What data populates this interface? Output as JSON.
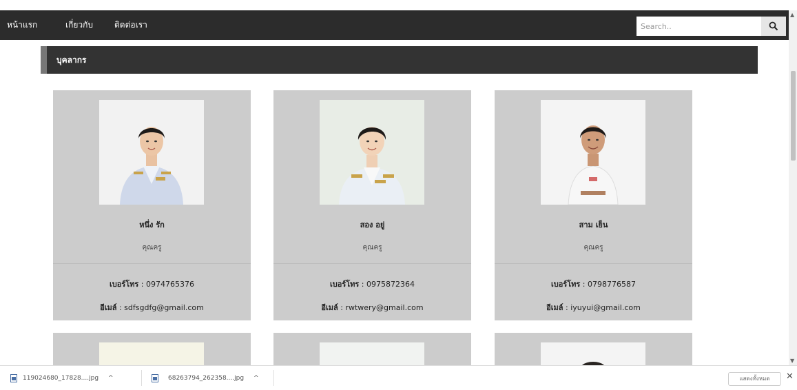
{
  "nav": {
    "items": [
      {
        "label": "หน้าแรก"
      },
      {
        "label": "เกี่ยวกับ"
      },
      {
        "label": "ติดต่อเรา"
      }
    ],
    "search_placeholder": "Search.."
  },
  "section": {
    "title": "บุคลากร"
  },
  "staff": [
    {
      "name": "หนึ่ง รัก",
      "role": "คุณครู",
      "phone_label": "เบอร์โทร",
      "phone": " : 0974765376",
      "email_label": "อีเมล์",
      "email": " : sdfsgdfg@gmail.com"
    },
    {
      "name": "สอง อยู่",
      "role": "คุณครู",
      "phone_label": "เบอร์โทร",
      "phone": " : 0975872364",
      "email_label": "อีเมล์",
      "email": " : rwtwery@gmail.com"
    },
    {
      "name": "สาม เย็น",
      "role": "คุณครู",
      "phone_label": "เบอร์โทร",
      "phone": " : 0798776587",
      "email_label": "อีเมล์",
      "email": " : iyuyui@gmail.com"
    }
  ],
  "downloads": {
    "items": [
      {
        "filename": "119024680_17828....jpg"
      },
      {
        "filename": "68263794_262358....jpg"
      }
    ],
    "show_all_label": "แสดงทั้งหมด"
  },
  "colors": {
    "navbar": "#2c2c2c",
    "section_header": "#333333",
    "card_bg": "#cccccc"
  }
}
